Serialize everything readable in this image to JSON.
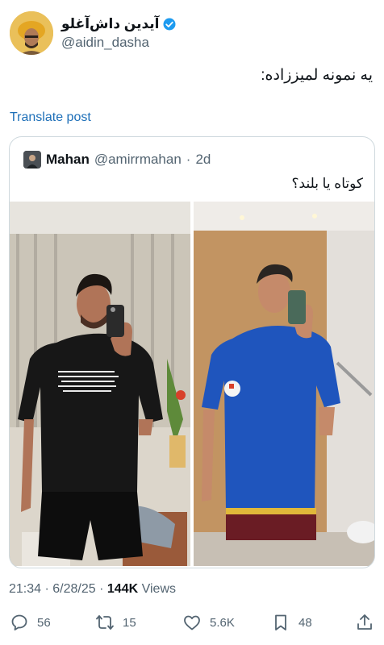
{
  "post": {
    "author": {
      "display_name": "آیدین داش‌آغلو",
      "handle": "@aidin_dasha",
      "verified_color": "#1d9bf0"
    },
    "text": "یه نمونه لمیززاده:",
    "translate_label": "Translate post",
    "quoted": {
      "name": "Mahan",
      "handle": "@amirrmahan",
      "separator": "·",
      "time": "2d",
      "text": "کوتاه یا بلند؟"
    },
    "time": "21:34",
    "date": "6/28/25",
    "views_count": "144K",
    "views_label": "Views",
    "actions": {
      "replies": "56",
      "reposts": "15",
      "likes": "5.6K",
      "bookmarks": "48"
    },
    "icons": [
      "reply-icon",
      "repost-icon",
      "like-icon",
      "bookmark-icon",
      "share-icon"
    ]
  }
}
